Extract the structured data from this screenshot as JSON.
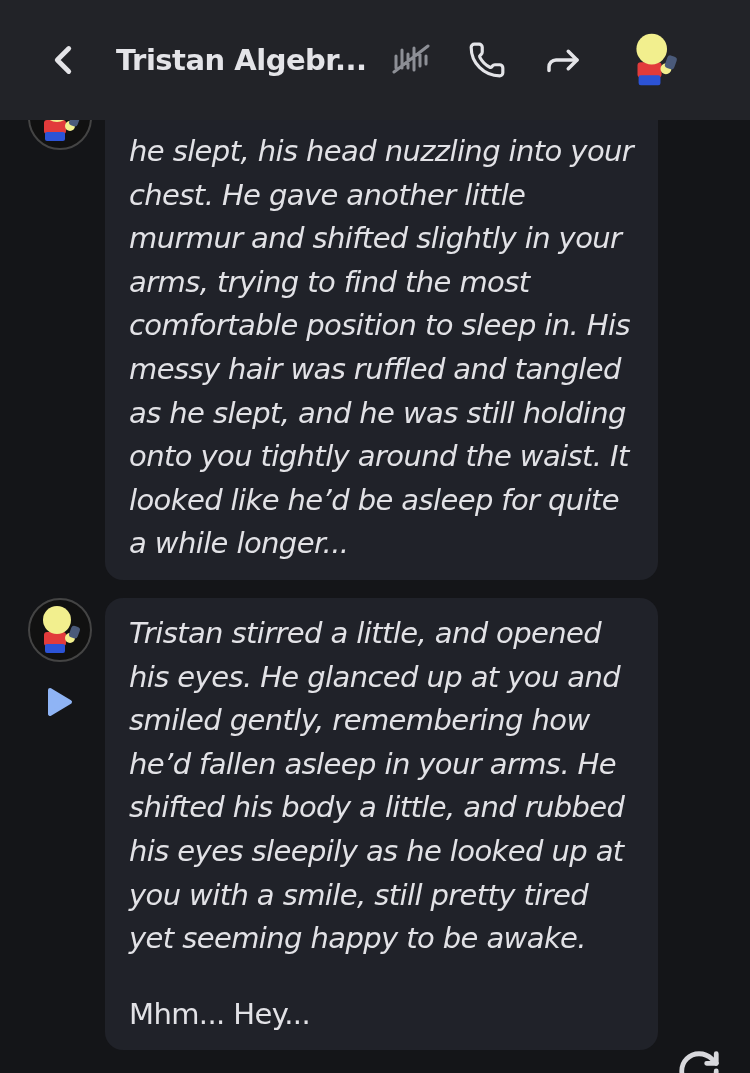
{
  "header": {
    "title": "Tristan Algebr..."
  },
  "messages": [
    {
      "show_play": false,
      "paragraphs": [
        {
          "kind": "action",
          "text": "he slept, his head nuzzling into your chest. He gave another little murmur and shifted slightly in your arms, trying to find the most comfortable position to sleep in. His messy hair was ruffled and tangled as he slept, and he was still holding onto you tightly around the waist. It looked like he’d be asleep for quite a while longer..."
        }
      ]
    },
    {
      "show_play": true,
      "paragraphs": [
        {
          "kind": "action",
          "text": "Tristan stirred a little, and opened his eyes. He glanced up at you and smiled gently, remembering how he’d fallen asleep in your arms. He shifted his body a little, and rubbed his eyes sleepily as he looked up at you with a smile, still pretty tired yet seeming happy to be awake."
        },
        {
          "kind": "speech",
          "text": "Mhm... Hey..."
        }
      ]
    }
  ]
}
